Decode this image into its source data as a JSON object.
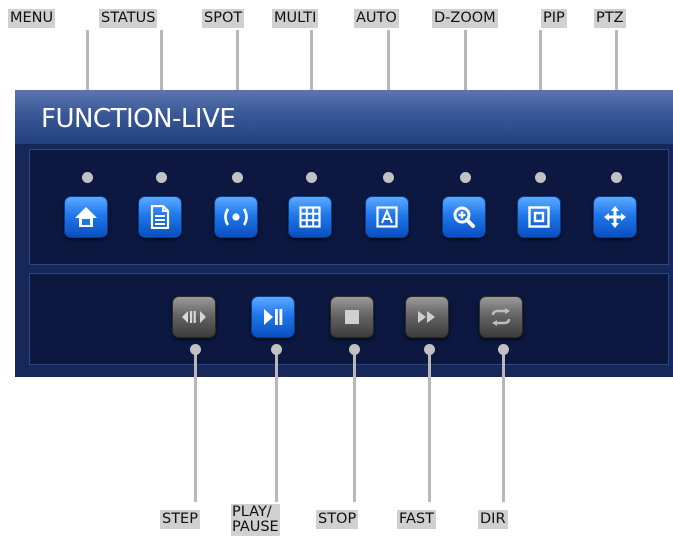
{
  "top_labels": {
    "menu": "MENU",
    "status": "STATUS",
    "spot": "SPOT",
    "multi": "MULTI",
    "auto": "AUTO",
    "dzoom": "D-ZOOM",
    "pip": "PIP",
    "ptz": "PTZ"
  },
  "bottom_labels": {
    "step": "STEP",
    "play_pause_line1": "PLAY/",
    "play_pause_line2": "PAUSE",
    "stop": "STOP",
    "fast": "FAST",
    "dir": "DIR"
  },
  "panel": {
    "title": "FUNCTION-LIVE"
  },
  "icons": {
    "menu": "home-icon",
    "status": "document-icon",
    "spot": "spot-icon",
    "multi": "grid-icon",
    "auto": "auto-letter-a-icon",
    "dzoom": "zoom-in-icon",
    "pip": "picture-in-picture-icon",
    "ptz": "move-arrows-icon",
    "step": "step-icon",
    "play_pause": "play-pause-icon",
    "stop": "stop-icon",
    "fast": "fast-forward-icon",
    "dir": "direction-icon"
  },
  "colors": {
    "active_button": "#1f78ea",
    "inactive_button": "#656565",
    "panel_background": "#16275a",
    "label_background": "#d0d0d0",
    "leader_line": "#b8b8b8"
  }
}
